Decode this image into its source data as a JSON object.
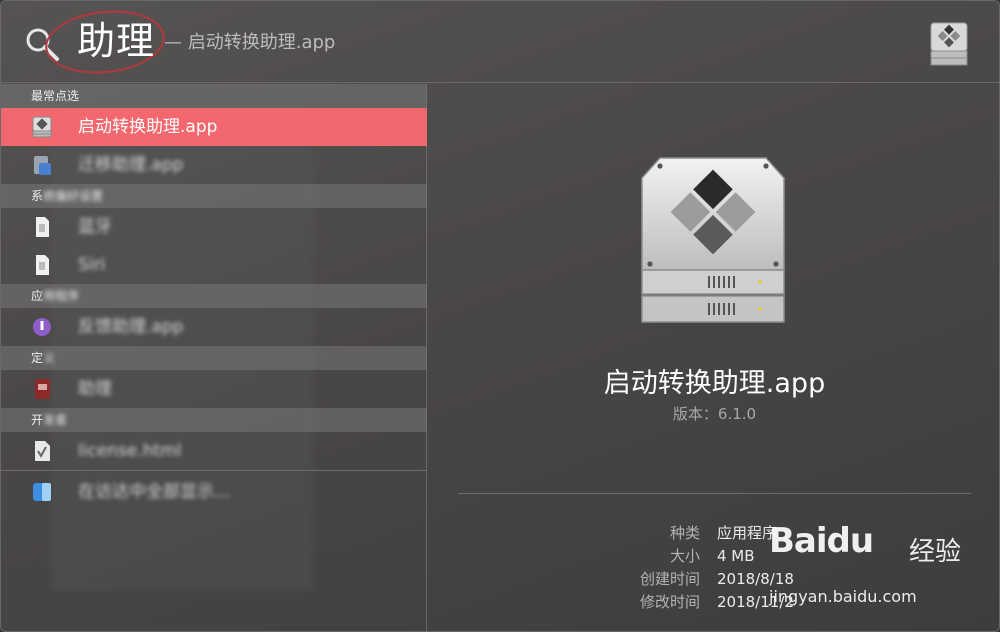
{
  "search": {
    "query": "助理",
    "completion": "— 启动转换助理.app"
  },
  "results": {
    "sections": [
      {
        "header": "最常点选",
        "header_blurred_tail": ""
      },
      {
        "header": "系",
        "header_blurred_tail": "统偏好设置"
      },
      {
        "header": "应",
        "header_blurred_tail": "用程序"
      },
      {
        "header": "定",
        "header_blurred_tail": "义"
      },
      {
        "header": "开",
        "header_blurred_tail": "发者"
      }
    ],
    "items": [
      {
        "label": "启动转换助理.app",
        "icon": "boot-camp-icon",
        "selected": true
      },
      {
        "label": "迁移助理.app",
        "icon": "migration-assistant-icon",
        "blurred": true
      },
      {
        "label": "蓝牙",
        "icon": "document-icon",
        "blurred": true
      },
      {
        "label": "Siri",
        "icon": "document-icon",
        "blurred": true
      },
      {
        "label": "反馈助理.app",
        "icon": "feedback-assistant-icon",
        "blurred": true
      },
      {
        "label": "助理",
        "icon": "dictionary-icon",
        "blurred": true
      },
      {
        "label": "license.html",
        "icon": "html-file-icon",
        "blurred": true
      },
      {
        "label": "在访达中全部显示...",
        "icon": "finder-icon",
        "blurred": true
      }
    ]
  },
  "preview": {
    "app_name": "启动转换助理.app",
    "version": "版本：6.1.0",
    "meta": [
      {
        "key": "种类",
        "value": "应用程序"
      },
      {
        "key": "大小",
        "value": "4 MB"
      },
      {
        "key": "创建时间",
        "value": "2018/8/18"
      },
      {
        "key": "修改时间",
        "value": "2018/11/2"
      }
    ]
  },
  "watermark": {
    "brand": "Baidu",
    "cn": "经验",
    "url": "jingyan.baidu.com"
  },
  "colors": {
    "selection": "#f2686e",
    "background": "#4a4747",
    "annotation_ring": "#b3373d"
  }
}
